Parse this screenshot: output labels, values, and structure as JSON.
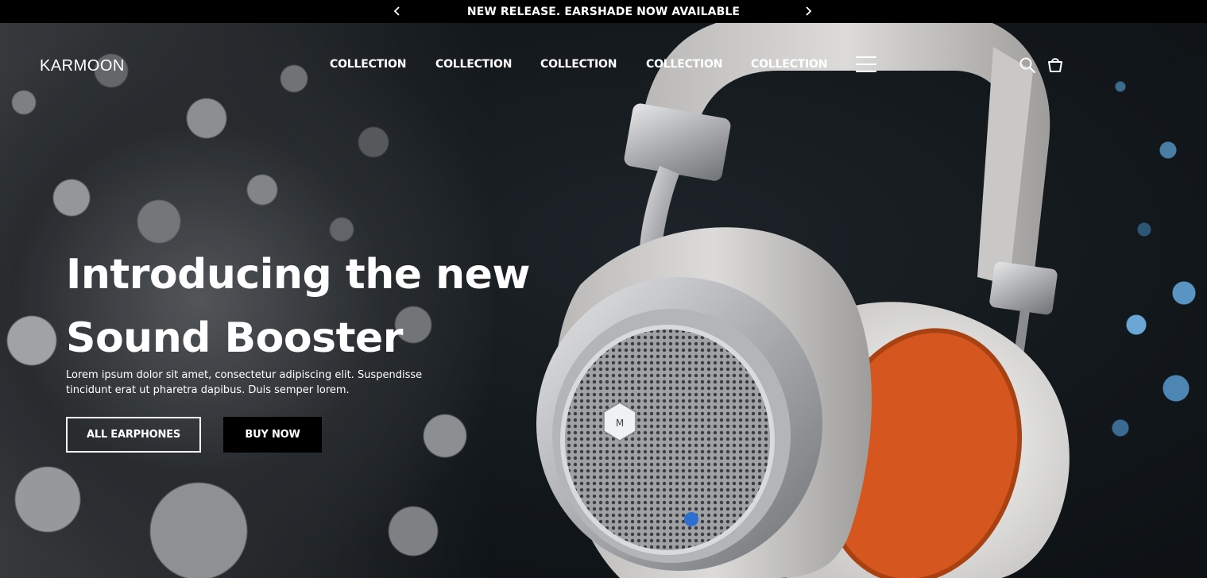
{
  "announcement": {
    "text": "NEW RELEASE. EARSHADE NOW AVAILABLE",
    "prev_icon": "chevron-left-icon",
    "next_icon": "chevron-right-icon"
  },
  "header": {
    "logo": "KARMOON",
    "menu": [
      "COLLECTION",
      "COLLECTION",
      "COLLECTION",
      "COLLECTION",
      "COLLECTION"
    ],
    "menu_icon": "hamburger-icon",
    "search_icon": "search-icon",
    "cart_icon": "shopping-bag-icon"
  },
  "hero": {
    "title_line1": "Introducing the new",
    "title_line2": "Sound Booster",
    "subtitle": "Lorem ipsum dolor sit amet, consectetur adipiscing elit. Suspendisse tincidunt erat ut pharetra dapibus. Duis semper lorem.",
    "btn_primary": "ALL EARPHONES",
    "btn_secondary": "BUY NOW"
  },
  "colors": {
    "bar": "#000000",
    "text": "#ffffff",
    "accent_orange": "#d9531b",
    "buy_button": "#000000"
  }
}
